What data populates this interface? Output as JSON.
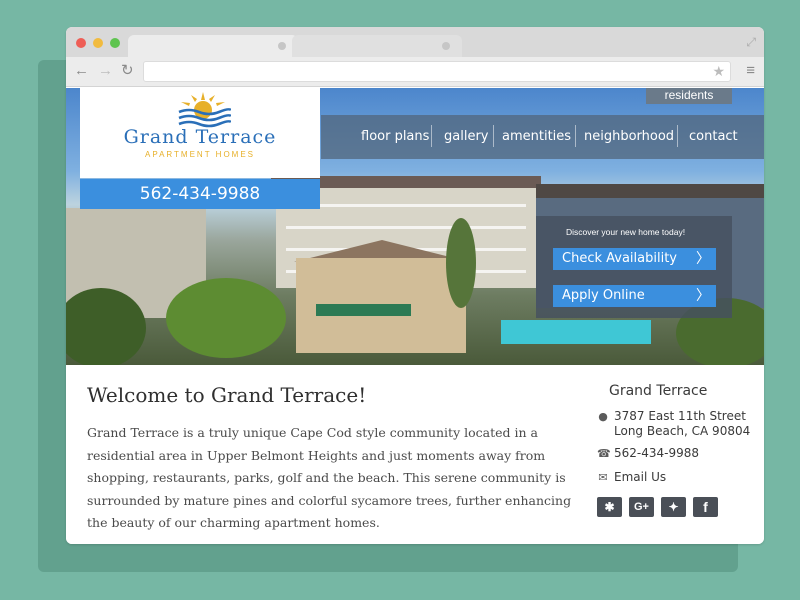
{
  "site": {
    "logo_name": "Grand Terrace",
    "logo_sub": "APARTMENT HOMES",
    "phone": "562-434-9988"
  },
  "nav": {
    "residents": "residents",
    "items": [
      {
        "label": "floor plans"
      },
      {
        "label": "gallery"
      },
      {
        "label": "amentities"
      },
      {
        "label": "neighborhood"
      },
      {
        "label": "contact"
      }
    ]
  },
  "cta": {
    "tagline": "Discover your new home today!",
    "check_label": "Check  Availability",
    "apply_label": "Apply Online"
  },
  "main": {
    "welcome": "Welcome to Grand Terrace!",
    "body": "Grand Terrace is a truly unique Cape Cod style community located in a residential area in Upper Belmont Heights and just moments away from shopping, restaurants, parks, golf and the beach. This serene community is surrounded by mature pines and colorful sycamore trees, further enhancing the beauty of our charming apartment homes."
  },
  "sidebar": {
    "title": "Grand Terrace",
    "address_line1": "3787 East 11th Street",
    "address_line2": "Long Beach, CA 90804",
    "phone": "562-434-9988",
    "email_label": "Email Us"
  },
  "icons": {
    "social": [
      "yelp-icon",
      "google-plus-icon",
      "twitter-icon",
      "facebook-icon"
    ]
  },
  "colors": {
    "accent": "#3b8fde",
    "logo_blue": "#2a6fb8",
    "logo_gold": "#e7b02a",
    "background": "#76b7a4"
  }
}
